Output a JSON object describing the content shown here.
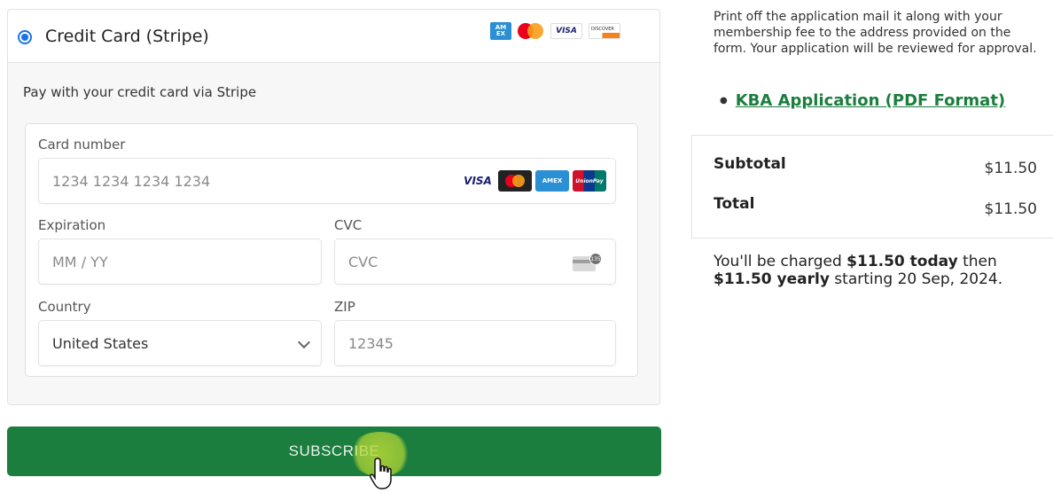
{
  "payment": {
    "method_label": "Credit Card (Stripe)",
    "brands": [
      "amex",
      "mastercard",
      "visa",
      "discover"
    ],
    "description": "Pay with your credit card via Stripe",
    "card_number": {
      "label": "Card number",
      "placeholder": "1234 1234 1234 1234",
      "brand_icons": [
        "visa",
        "mastercard",
        "amex",
        "unionpay"
      ]
    },
    "expiration": {
      "label": "Expiration",
      "placeholder": "MM / YY"
    },
    "cvc": {
      "label": "CVC",
      "placeholder": "CVC",
      "icon_badge": "135"
    },
    "country": {
      "label": "Country",
      "value": "United States"
    },
    "zip": {
      "label": "ZIP",
      "placeholder": "12345"
    }
  },
  "subscribe_label": "SUBSCRIBE",
  "sidebar": {
    "info_text": "Print off the application mail it along with your membership fee to the address provided on the form. Your application will be reviewed for approval.",
    "link_text": "KBA Application (PDF Format)",
    "subtotal_label": "Subtotal",
    "subtotal_value": "$11.50",
    "total_label": "Total",
    "total_value": "$11.50",
    "charge": {
      "prefix": "You'll be charged ",
      "today_amount": "$11.50 today",
      "middle": " then ",
      "yearly_amount": "$11.50 yearly",
      "suffix": " starting 20 Sep, 2024."
    }
  },
  "colors": {
    "accent_green": "#1b7e3e",
    "radio_blue": "#1a73e8"
  }
}
